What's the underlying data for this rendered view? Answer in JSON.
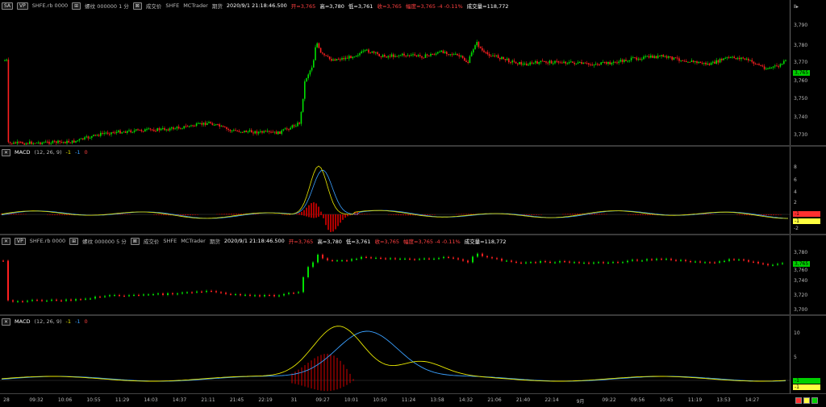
{
  "pane1": {
    "buttons": [
      "SA",
      "VP"
    ],
    "symbol": "SHFE.rb 0000",
    "name_text": "螺纹 000000 1 分",
    "exec_label": "成交价",
    "exchange": "SHFE",
    "source": "MCTrader",
    "futures": "期货",
    "datetime": "2020/9/1 21:18:46.500",
    "open": "开=3,765",
    "high": "高=3,780",
    "low": "低=3,761",
    "close": "收=3,765",
    "change": "幅度=3,765 -4 -0.11%",
    "volume": "成交量=118,772",
    "axis": [
      "3,790",
      "3,780",
      "3,770",
      "3,760",
      "3,750",
      "3,740",
      "3,730"
    ],
    "price_tag": "3,765",
    "price_tag2": "3,765",
    "top_right": "Ⅱ▸",
    "price_path": [
      [
        10,
        178
      ],
      [
        90,
        176
      ],
      [
        130,
        165
      ],
      [
        170,
        162
      ],
      [
        210,
        160
      ],
      [
        245,
        155
      ],
      [
        260,
        152
      ],
      [
        285,
        162
      ],
      [
        320,
        164
      ],
      [
        345,
        165
      ],
      [
        360,
        158
      ],
      [
        372,
        152
      ],
      [
        378,
        100
      ],
      [
        388,
        80
      ],
      [
        392,
        50
      ],
      [
        397,
        66
      ],
      [
        410,
        74
      ],
      [
        430,
        72
      ],
      [
        455,
        63
      ],
      [
        475,
        70
      ],
      [
        500,
        68
      ],
      [
        525,
        70
      ],
      [
        550,
        64
      ],
      [
        570,
        70
      ],
      [
        580,
        78
      ],
      [
        590,
        52
      ],
      [
        600,
        66
      ],
      [
        615,
        70
      ],
      [
        630,
        75
      ],
      [
        650,
        80
      ],
      [
        670,
        77
      ],
      [
        700,
        77
      ],
      [
        730,
        80
      ],
      [
        760,
        78
      ],
      [
        790,
        72
      ],
      [
        820,
        70
      ],
      [
        850,
        75
      ],
      [
        880,
        80
      ],
      [
        900,
        72
      ],
      [
        920,
        72
      ],
      [
        935,
        78
      ],
      [
        950,
        85
      ],
      [
        965,
        82
      ],
      [
        975,
        75
      ]
    ]
  },
  "macd1": {
    "title": "MACD",
    "params": "(12, 26, 9)",
    "v1": "-1",
    "v2": "-1",
    "v3": "0",
    "axis": [
      "8",
      "6",
      "4",
      "2"
    ],
    "axis_neg": "-2",
    "tag1": "-1",
    "tag2": "-1"
  },
  "pane3": {
    "symbol": "SHFE.rb 0000",
    "name_text": "螺纹 000000 5 分",
    "exec_label": "成交价",
    "exchange": "SHFE",
    "source": "MCTrader",
    "futures": "期货",
    "datetime": "2020/9/1 21:18:46.500",
    "open": "开=3,765",
    "high": "高=3,780",
    "low": "低=3,761",
    "close": "收=3,765",
    "change": "幅度=3,765 -4 -0.11%",
    "volume": "成交量=118,772",
    "axis": [
      "3,780",
      "3,760",
      "3,740",
      "3,720",
      "3,700"
    ],
    "price_tag": "3,765",
    "price_tag2": "3,765"
  },
  "macd2": {
    "title": "MACD",
    "params": "(12, 26, 9)",
    "v1": "-1",
    "v2": "-1",
    "v3": "0",
    "axis": [
      "10",
      "5"
    ],
    "tag1": "-1",
    "tag2": "-1"
  },
  "xaxis": {
    "labels": [
      "28",
      "09:32",
      "10:06",
      "10:55",
      "11:29",
      "14:03",
      "14:37",
      "21:11",
      "21:45",
      "22:19",
      "31",
      "09:27",
      "10:01",
      "10:50",
      "11:24",
      "13:58",
      "14:32",
      "21:06",
      "21:40",
      "22:14",
      "9月",
      "09:22",
      "09:56",
      "10:45",
      "11:19",
      "13:53",
      "14:27"
    ]
  },
  "colors": {
    "bull": "#00e000",
    "bear": "#ff2020",
    "macd_yellow": "#e8e800",
    "macd_blue": "#3aa0ff",
    "hist_red": "#b00000",
    "tag_green": "#00d000",
    "tag_yellow": "#ffff40"
  }
}
